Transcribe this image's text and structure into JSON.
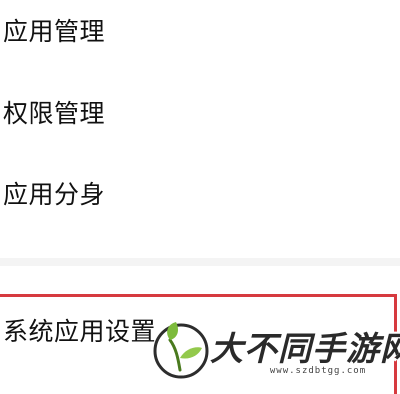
{
  "menu": {
    "items": [
      {
        "label": "应用管理"
      },
      {
        "label": "权限管理"
      },
      {
        "label": "应用分身"
      }
    ],
    "system_section": {
      "label": "系统应用设置"
    }
  },
  "watermark": {
    "title": "大不同手游网",
    "url": "www.szdbtgg.com",
    "logo_icon": "sprout-leaf-icon"
  },
  "colors": {
    "highlight": "#d63a3f",
    "text": "#111111",
    "logo_leaf": "#7dbb3c",
    "logo_ring": "#2d2d2d"
  }
}
